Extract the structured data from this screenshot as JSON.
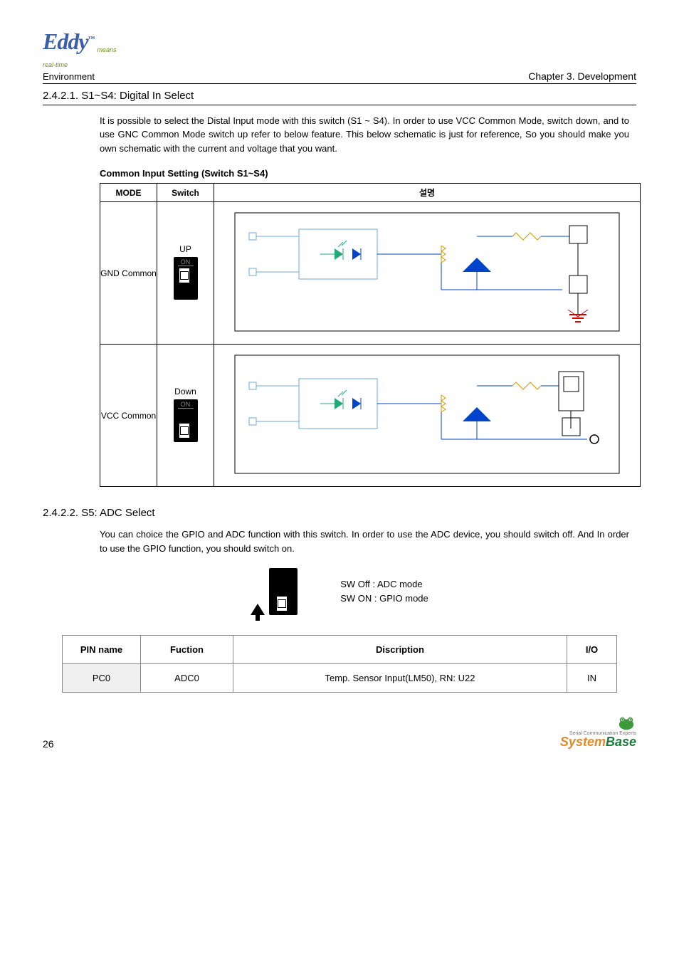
{
  "header": {
    "logo_main": "Eddy",
    "logo_tm": "™",
    "logo_sub1": "means",
    "logo_sub2": "real-time",
    "env": "Environment",
    "chapter": "Chapter 3. Development"
  },
  "section1": {
    "num_title": "2.4.2.1. S1~S4: Digital In Select",
    "para": "It is possible to select the Distal Input mode with this switch (S1 ~ S4). In order to use VCC Common Mode, switch down, and to use GNC Common Mode switch up refer to below feature. This below schematic is just for reference, So you should make you own schematic with the current and  voltage that you want.",
    "sub_bold": "Common Input Setting (Switch S1~S4)",
    "table": {
      "h_mode": "MODE",
      "h_switch": "Switch",
      "h_desc": "설명",
      "r1_mode": "GND Common",
      "r1_sw_pos": "UP",
      "r2_mode": "VCC Common",
      "r2_sw_pos": "Down"
    }
  },
  "section2": {
    "num_title": "2.4.2.2. S5: ADC Select",
    "para": "You can choice the GPIO and ADC function with this switch. In order to use the ADC device, you should switch off. And In order to use the GPIO function, you should switch on.",
    "sw_off": "SW Off : ADC mode",
    "sw_on": "SW ON : GPIO mode"
  },
  "pin_table": {
    "h_pin": "PIN name",
    "h_func": "Fuction",
    "h_desc": "Discription",
    "h_io": "I/O",
    "r1_pin": "PC0",
    "r1_func": "ADC0",
    "r1_desc": "Temp. Sensor Input(LM50), RN: U22",
    "r1_io": "IN"
  },
  "footer": {
    "page": "26",
    "tagline": "Serial Communication Experts",
    "brand_s": "System",
    "brand_b": "Base"
  }
}
